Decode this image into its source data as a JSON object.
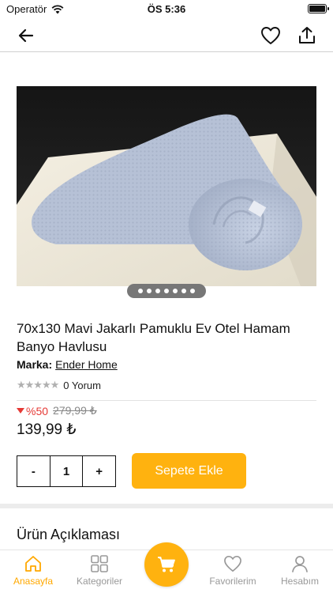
{
  "status_bar": {
    "carrier": "Operatör",
    "time": "ÖS 5:36"
  },
  "nav": {
    "back_icon": "arrow-left-icon",
    "favorite_icon": "heart-icon",
    "share_icon": "share-icon"
  },
  "product": {
    "title": "70x130 Mavi Jakarlı Pamuklu Ev Otel Hamam Banyo Havlusu",
    "brand_label": "Marka:",
    "brand_name": "Ender Home",
    "rating_stars": "★★★★★",
    "review_count": "0 Yorum",
    "discount": "%50",
    "old_price": "279,99 ₺",
    "price": "139,99 ₺",
    "image_pages": 7,
    "image_current_page": 1
  },
  "cart_controls": {
    "minus": "-",
    "quantity": "1",
    "plus": "+",
    "add_to_cart": "Sepete Ekle"
  },
  "description": {
    "title": "Ürün Açıklaması"
  },
  "tab_bar": {
    "items": [
      {
        "label": "Anasayfa",
        "icon": "home-icon",
        "active": true
      },
      {
        "label": "Kategoriler",
        "icon": "grid-icon",
        "active": false
      },
      {
        "label": "Favorilerim",
        "icon": "heart-icon",
        "active": false
      },
      {
        "label": "Hesabım",
        "icon": "user-icon",
        "active": false
      }
    ],
    "cart_icon": "cart-icon"
  },
  "colors": {
    "accent": "#ffb20f",
    "discount": "#e53935",
    "active_tab": "#ffa800"
  }
}
